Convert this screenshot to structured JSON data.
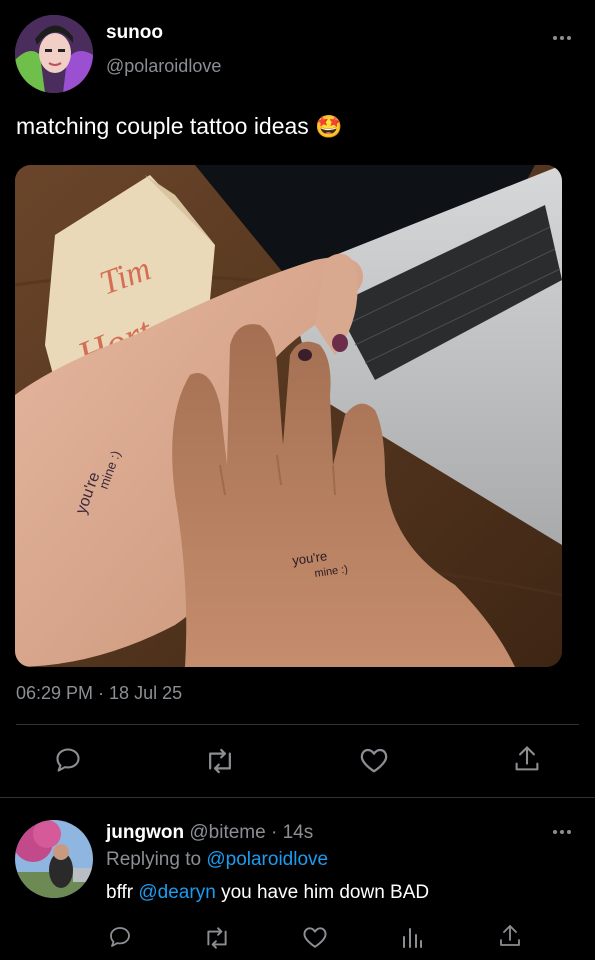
{
  "tweet": {
    "author_name": "sunoo",
    "author_handle": "@polaroidlove",
    "text": "matching couple tattoo ideas",
    "emoji": "🤩",
    "timestamp": "06:29 PM · 18 Jul 25",
    "image": {
      "bag_text_line1": "Tim",
      "bag_text_line2": "Hort",
      "palm_text_left_1": "you're",
      "palm_text_left_2": "mine :)",
      "palm_text_right_1": "you're",
      "palm_text_right_2": "mine :)"
    }
  },
  "reply": {
    "author_name": "jungwon",
    "author_handle": "@biteme",
    "age": "· 14s",
    "replying_prefix": "Replying to",
    "replying_to": "@polaroidlove",
    "text_before": "bffr",
    "mention": "@dearyn",
    "text_after": "you have him down BAD"
  },
  "icons": {
    "more": "more-dots-icon",
    "reply": "reply-bubble-icon",
    "retweet": "retweet-icon",
    "like": "heart-icon",
    "share": "share-icon",
    "views": "views-bars-icon"
  },
  "colors": {
    "background": "#000000",
    "text": "#e7e9ea",
    "muted": "#8b8f94",
    "link": "#1d9bf0",
    "divider": "#2f3336"
  }
}
